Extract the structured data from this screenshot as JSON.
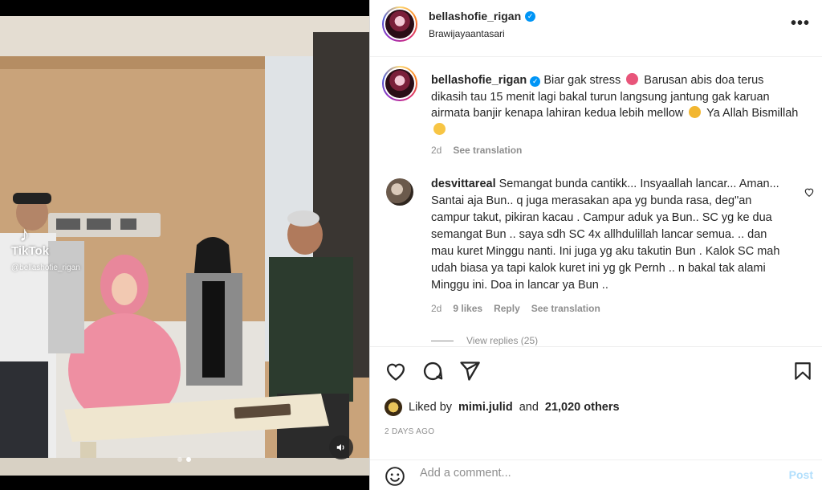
{
  "header": {
    "username": "bellashofie_rigan",
    "location": "Brawijayaantasari",
    "more_icon": "more-horizontal-icon"
  },
  "media": {
    "watermark_logo": "TikTok",
    "watermark_handle": "@bellashofie_rigan",
    "carousel_total": 2,
    "carousel_active": 2
  },
  "caption": {
    "username": "bellashofie_rigan",
    "text_1": "Biar gak stress",
    "text_2": "Barusan abis doa terus dikasih tau 15 menit lagi bakal turun langsung jantung gak karuan airmata banjir kenapa lahiran kedua lebih mellow",
    "text_3": "Ya Allah Bismillah",
    "age": "2d",
    "see_translation": "See translation"
  },
  "comment": {
    "username": "desvittareal",
    "text": "Semangat bunda cantikk... Insyaallah lancar... Aman... Santai aja Bun.. q juga merasakan apa yg bunda rasa, deg\"an campur takut, pikiran kacau . Campur aduk ya Bun.. SC yg ke dua semangat Bun .. saya sdh SC 4x allhdulillah lancar semua. .. dan mau kuret Minggu nanti. Ini juga yg aku takutin Bun . Kalok SC mah udah biasa ya tapi kalok kuret ini yg gk Pernh .. n bakal tak alami Minggu ini. Doa in lancar ya Bun ..",
    "age": "2d",
    "likes": "9 likes",
    "reply": "Reply",
    "see_translation": "See translation",
    "view_replies": "View replies (25)"
  },
  "actions": {
    "liked_by_prefix": "Liked by",
    "liked_by_user": "mimi.julid",
    "liked_by_and": "and",
    "liked_by_others": "21,020 others",
    "date": "2 DAYS AGO"
  },
  "add_comment": {
    "placeholder": "Add a comment...",
    "post_label": "Post"
  },
  "colors": {
    "verified": "#0095f6",
    "post_disabled": "#b2dffc",
    "secondary_text": "#8e8e8e"
  }
}
